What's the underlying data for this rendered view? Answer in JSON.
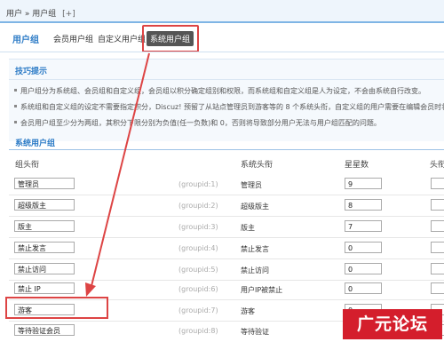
{
  "breadcrumb": {
    "root": "用户",
    "sep": "»",
    "current": "用户组",
    "add": "[+]"
  },
  "tabs": [
    "用户组",
    "会员用户组",
    "自定义用户组",
    "系统用户组"
  ],
  "tips": {
    "title": "技巧提示",
    "lines": [
      "用户组分为系统组、会员组和自定义组，会员组以积分确定组别和权限，而系统组和自定义组是人为设定，不会由系统自行改变。",
      "系统组和自定义组的设定不需要指定积分，Discuz! 预留了从站点管理员到游客等的 8 个系统头衔，自定义组的用户需要在编辑会员时将",
      "会员用户组至少分为两组，其积分下限分别为负值(任一负数)和 0，否则将导致部分用户无法与用户组匹配的问题。"
    ]
  },
  "section_title": "系统用户组",
  "columns": {
    "name": "组头衔",
    "system": "系统头衔",
    "stars": "星星数",
    "head": "头衔"
  },
  "rows": [
    {
      "name": "管理员",
      "gid": "(groupid:1)",
      "system": "管理员",
      "stars": "9"
    },
    {
      "name": "超级版主",
      "gid": "(groupid:2)",
      "system": "超级版主",
      "stars": "8"
    },
    {
      "name": "版主",
      "gid": "(groupid:3)",
      "system": "版主",
      "stars": "7"
    },
    {
      "name": "禁止发言",
      "gid": "(groupid:4)",
      "system": "禁止发言",
      "stars": "0"
    },
    {
      "name": "禁止访问",
      "gid": "(groupid:5)",
      "system": "禁止访问",
      "stars": "0"
    },
    {
      "name": "禁止 IP",
      "gid": "(groupid:6)",
      "system": "用户IP被禁止",
      "stars": "0"
    },
    {
      "name": "游客",
      "gid": "(groupid:7)",
      "system": "游客",
      "stars": "0"
    },
    {
      "name": "等待验证会员",
      "gid": "(groupid:8)",
      "system": "等待验证",
      "stars": "0"
    }
  ],
  "watermark": "广元论坛",
  "colors": {
    "accent": "#2c7bc6",
    "highlight": "#d44444",
    "watermark_bg": "#d41e2c"
  }
}
